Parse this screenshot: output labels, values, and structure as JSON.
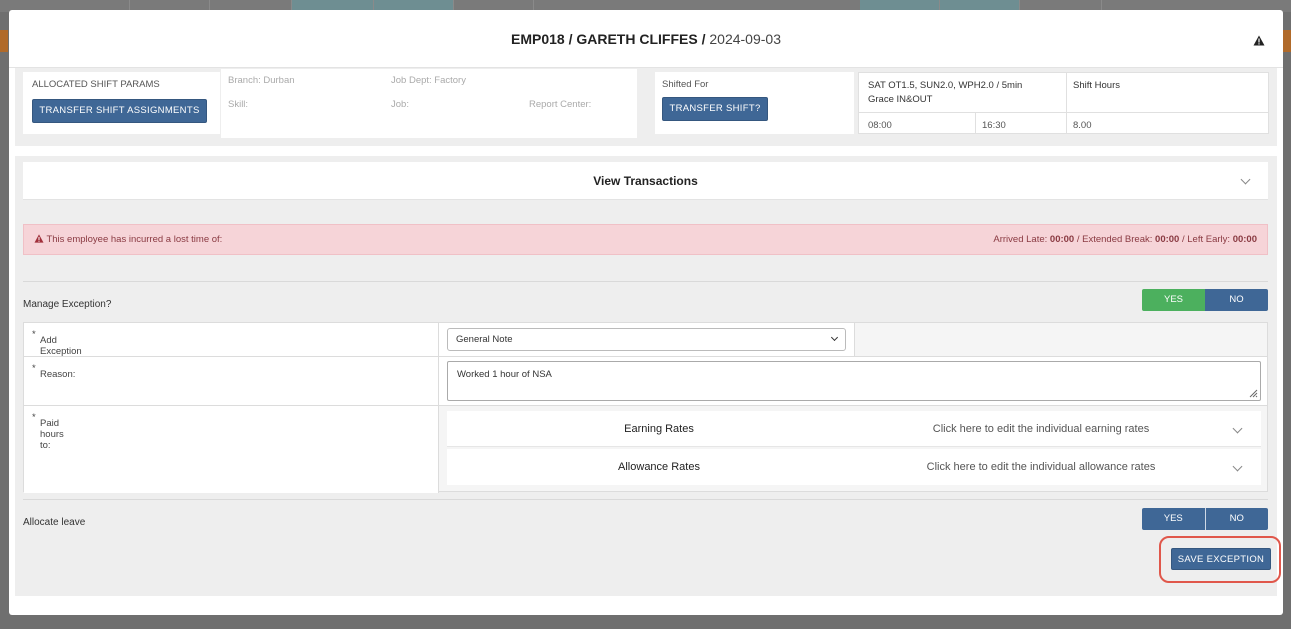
{
  "header": {
    "emp_code": "EMP018",
    "separator": "/",
    "emp_name": "GARETH CLIFFES",
    "separator2": "/",
    "date": "2024-09-03"
  },
  "params": {
    "allocated_label": "ALLOCATED SHIFT PARAMS",
    "transfer_assign_btn": "TRANSFER SHIFT ASSIGNMENTS",
    "branch": "Branch: Durban",
    "job_dept": "Job Dept: Factory",
    "skill": "Skill:",
    "job": "Job:",
    "report_center": "Report Center:",
    "shifted_for": "Shifted For",
    "transfer_shift_btn": "TRANSFER SHIFT?",
    "shift_rules": "SAT OT1.5, SUN2.0, WPH2.0 / 5min Grace IN&OUT",
    "shift_hours_label": "Shift Hours",
    "start": "08:00",
    "end": "16:30",
    "hours": "8.00"
  },
  "transactions": {
    "title": "View Transactions"
  },
  "alert": {
    "message": "This employee has incurred a lost time of:",
    "arrived_late_label": "Arrived Late:",
    "arrived_late": "00:00",
    "extended_break_label": "/ Extended Break:",
    "extended_break": "00:00",
    "left_early_label": "/ Left Early:",
    "left_early": "00:00"
  },
  "manage_exception": {
    "label": "Manage Exception?",
    "yes": "YES",
    "no": "NO",
    "selected": "YES"
  },
  "form": {
    "add_exception_label": "Add Exception",
    "exception_value": "General Note",
    "reason_label": "Reason:",
    "reason_value": "Worked 1 hour of NSA",
    "paid_hours_label": "Paid hours to:",
    "required_mark": "*",
    "earning_rates": "Earning Rates",
    "earning_hint": "Click here to edit the individual earning rates",
    "allowance_rates": "Allowance Rates",
    "allowance_hint": "Click here to edit the individual allowance rates"
  },
  "allocate_leave": {
    "label": "Allocate leave",
    "yes": "YES",
    "no": "NO"
  },
  "save_btn": "SAVE EXCEPTION",
  "colors": {
    "primary_blue": "#3f6796",
    "success_green": "#4cb05e",
    "alert_bg": "#f6d4d8",
    "highlight_red": "#e0574b"
  }
}
